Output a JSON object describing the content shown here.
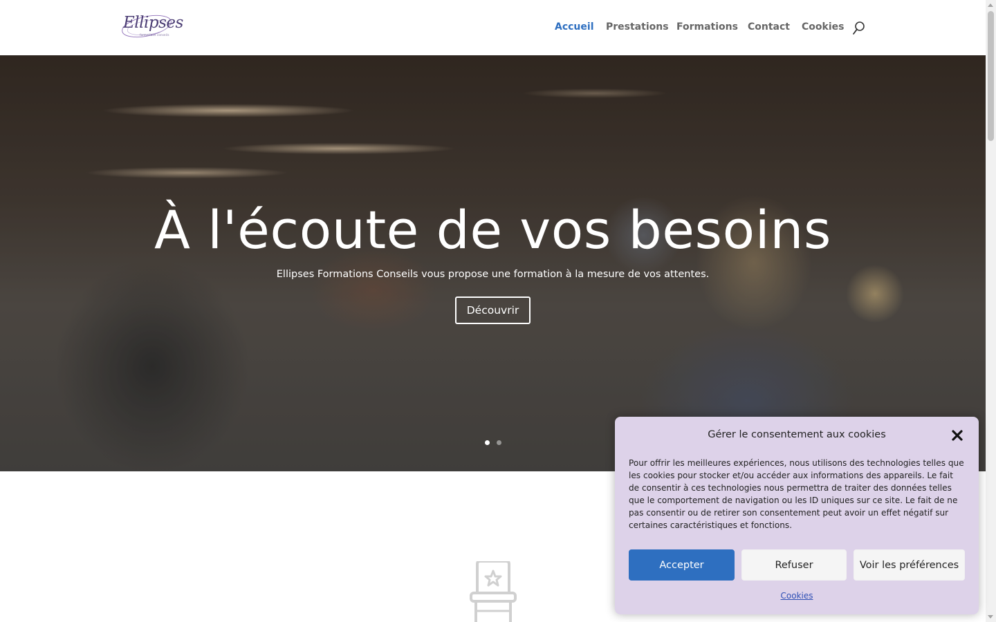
{
  "header": {
    "logo": {
      "name": "Ellipses",
      "tagline": "formations conseils"
    },
    "nav": [
      {
        "label": "Accueil",
        "active": true
      },
      {
        "label": "Prestations",
        "active": false
      },
      {
        "label": "Formations",
        "active": false
      },
      {
        "label": "Contact",
        "active": false
      },
      {
        "label": "Cookies",
        "active": false
      }
    ],
    "search_icon": "search-icon"
  },
  "hero": {
    "title": "À l'écoute de vos besoins",
    "subtitle": "Ellipses Formations Conseils vous propose une formation à la mesure de vos attentes.",
    "button": "Découvrir",
    "slides": {
      "count": 2,
      "active": 1
    }
  },
  "below_hero": {
    "icon": "chair-icon"
  },
  "cookie_banner": {
    "title": "Gérer le consentement aux cookies",
    "text": "Pour offrir les meilleures expériences, nous utilisons des technologies telles que les cookies pour stocker et/ou accéder aux informations des appareils. Le fait de consentir à ces technologies nous permettra de traiter des données telles que le comportement de navigation ou les ID uniques sur ce site. Le fait de ne pas consentir ou de retirer son consentement peut avoir un effet négatif sur certaines caractéristiques et fonctions.",
    "accept": "Accepter",
    "refuse": "Refuser",
    "preferences": "Voir les préférences",
    "link": "Cookies",
    "close_icon": "close-icon"
  },
  "colors": {
    "accent": "#2e6fc0",
    "nav_text": "#666666",
    "modal_bg": "#ddd2e9",
    "logo": "#4b3d74"
  }
}
